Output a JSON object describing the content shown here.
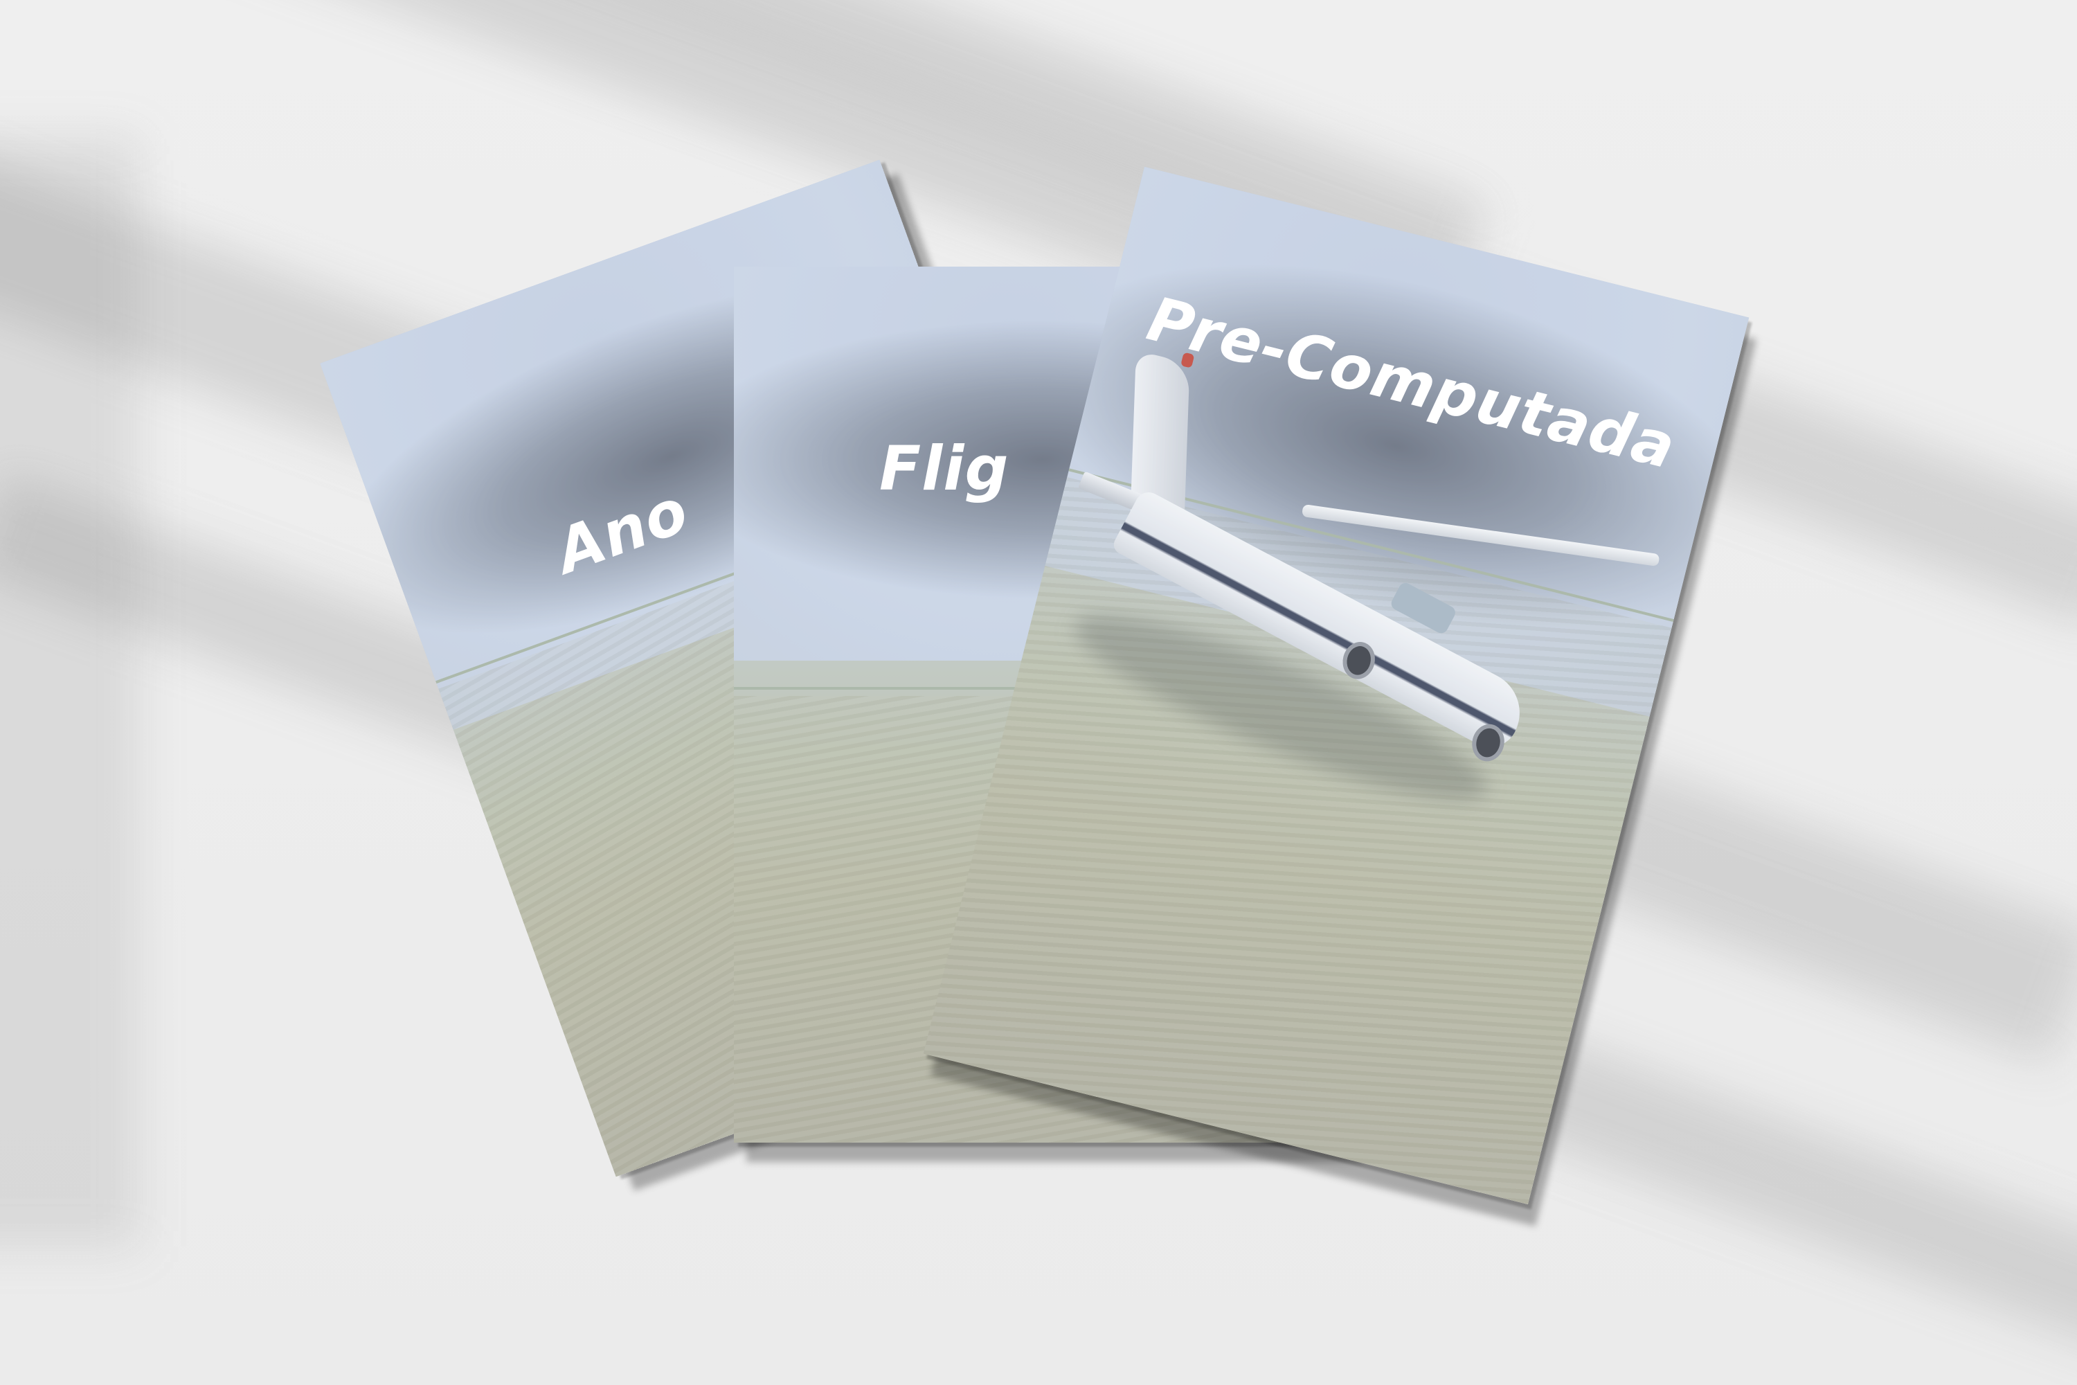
{
  "scene": {
    "description_hidden": false
  },
  "booklets": [
    {
      "title": "Anotaciones Extra",
      "visible_title": "Ano"
    },
    {
      "title": "Flight",
      "visible_title": "Flig"
    },
    {
      "title": "Pre-Computada",
      "visible_title": "Pre-Computada"
    }
  ],
  "colors": {
    "background": "#ececec",
    "sky": "#c7d3e3",
    "haze": "#5f697a",
    "grass": "#b3b49d",
    "title_text": "#ffffff",
    "stripe": "#2d3650"
  }
}
